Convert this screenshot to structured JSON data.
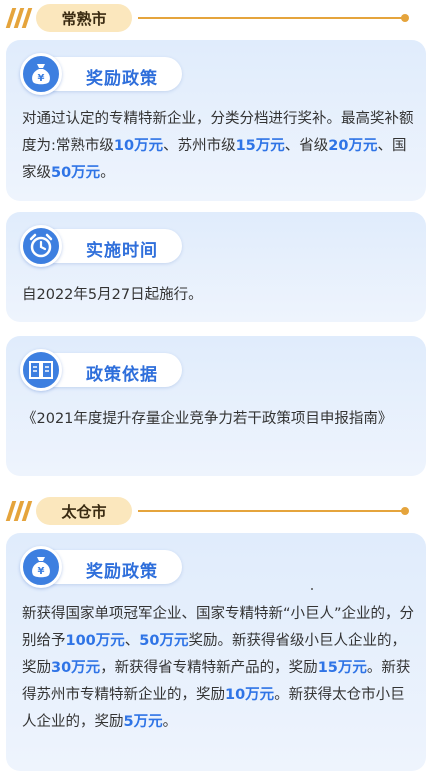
{
  "sections": [
    {
      "city": "常熟市",
      "cards": [
        {
          "title": "奖励政策",
          "icon": "money-bag-icon",
          "text_segments": [
            {
              "text": "对通过认定的专精特新企业，分类分档进行奖补。最高奖补额度为:常熟市级",
              "hl": false
            },
            {
              "text": "10万元",
              "hl": true
            },
            {
              "text": "、苏州市级",
              "hl": false
            },
            {
              "text": "15万元",
              "hl": true
            },
            {
              "text": "、省级",
              "hl": false
            },
            {
              "text": "20万元",
              "hl": true
            },
            {
              "text": "、国家级",
              "hl": false
            },
            {
              "text": "50万元",
              "hl": true
            },
            {
              "text": "。",
              "hl": false
            }
          ]
        },
        {
          "title": "实施时间",
          "icon": "alarm-clock-icon",
          "text_segments": [
            {
              "text": "自2022年5月27日起施行。",
              "hl": false
            }
          ]
        },
        {
          "title": "政策依据",
          "icon": "open-book-icon",
          "text_segments": [
            {
              "text": "《2021年度提升存量企业竞争力若干政策项目申报指南》",
              "hl": false
            }
          ]
        }
      ]
    },
    {
      "city": "太仓市",
      "cards": [
        {
          "title": "奖励政策",
          "icon": "money-bag-icon",
          "text_segments": [
            {
              "text": "新获得国家单项冠军企业、国家专精特新“小巨人”企业的，分别给予",
              "hl": false
            },
            {
              "text": "100万元",
              "hl": true
            },
            {
              "text": "、",
              "hl": false
            },
            {
              "text": "50万元",
              "hl": true
            },
            {
              "text": "奖励。新获得省级小巨人企业的，奖励",
              "hl": false
            },
            {
              "text": "30万元",
              "hl": true
            },
            {
              "text": "，新获得省专精特新产品的，奖励",
              "hl": false
            },
            {
              "text": "15万元",
              "hl": true
            },
            {
              "text": "。新获得苏州市专精特新企业的，奖励",
              "hl": false
            },
            {
              "text": "10万元",
              "hl": true
            },
            {
              "text": "。新获得太仓市小巨人企业的，奖励",
              "hl": false
            },
            {
              "text": "5万元",
              "hl": true
            },
            {
              "text": "。",
              "hl": false
            }
          ]
        }
      ]
    }
  ],
  "colors": {
    "accent_blue": "#2f74e6",
    "gold": "#e5a43c",
    "card_bg": "#e6effc"
  }
}
